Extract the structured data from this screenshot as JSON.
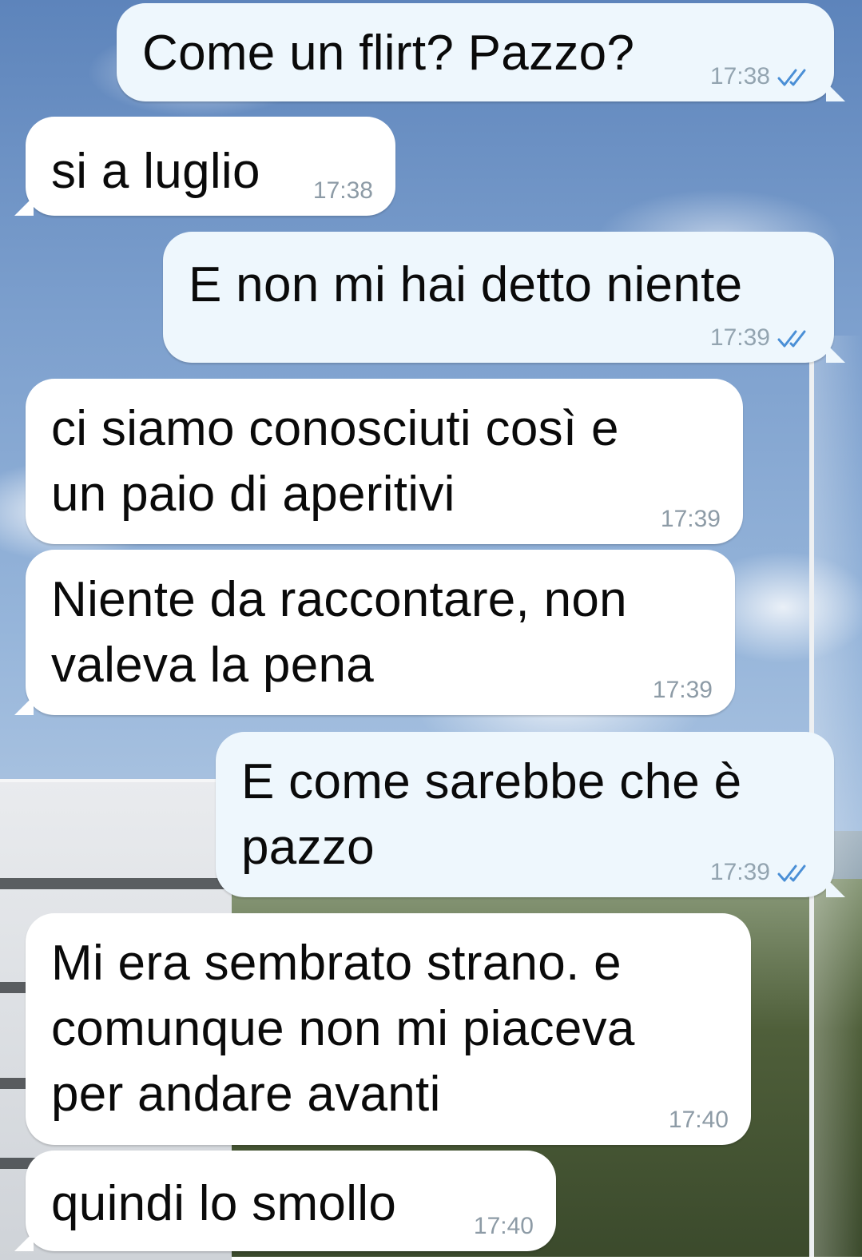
{
  "wallpaper": {
    "sky_color": "#7c9fcd"
  },
  "messages": [
    {
      "direction": "out",
      "text": "Come un flirt? Pazzo?",
      "time": "17:38",
      "status": "read-double-check"
    },
    {
      "direction": "in",
      "text": "si a luglio",
      "time": "17:38"
    },
    {
      "direction": "out",
      "text": "E non mi hai detto niente",
      "time": "17:39",
      "status": "read-double-check"
    },
    {
      "direction": "in",
      "text": "ci siamo conosciuti così e\nun paio di aperitivi",
      "time": "17:39"
    },
    {
      "direction": "in",
      "text": "Niente da raccontare, non\nvaleva la pena",
      "time": "17:39"
    },
    {
      "direction": "out",
      "text": "E come sarebbe che è\npazzo",
      "time": "17:39",
      "status": "read-double-check"
    },
    {
      "direction": "in",
      "text": "Mi era sembrato strano. e\ncomunque non mi piaceva\nper andare avanti",
      "time": "17:40"
    },
    {
      "direction": "in",
      "text": "quindi lo smollo",
      "time": "17:40"
    }
  ],
  "colors": {
    "incoming_bubble": "#ffffff",
    "outgoing_bubble": "#eef7fd",
    "read_check": "#4a8fd6",
    "timestamp": "#8d9ba6"
  }
}
